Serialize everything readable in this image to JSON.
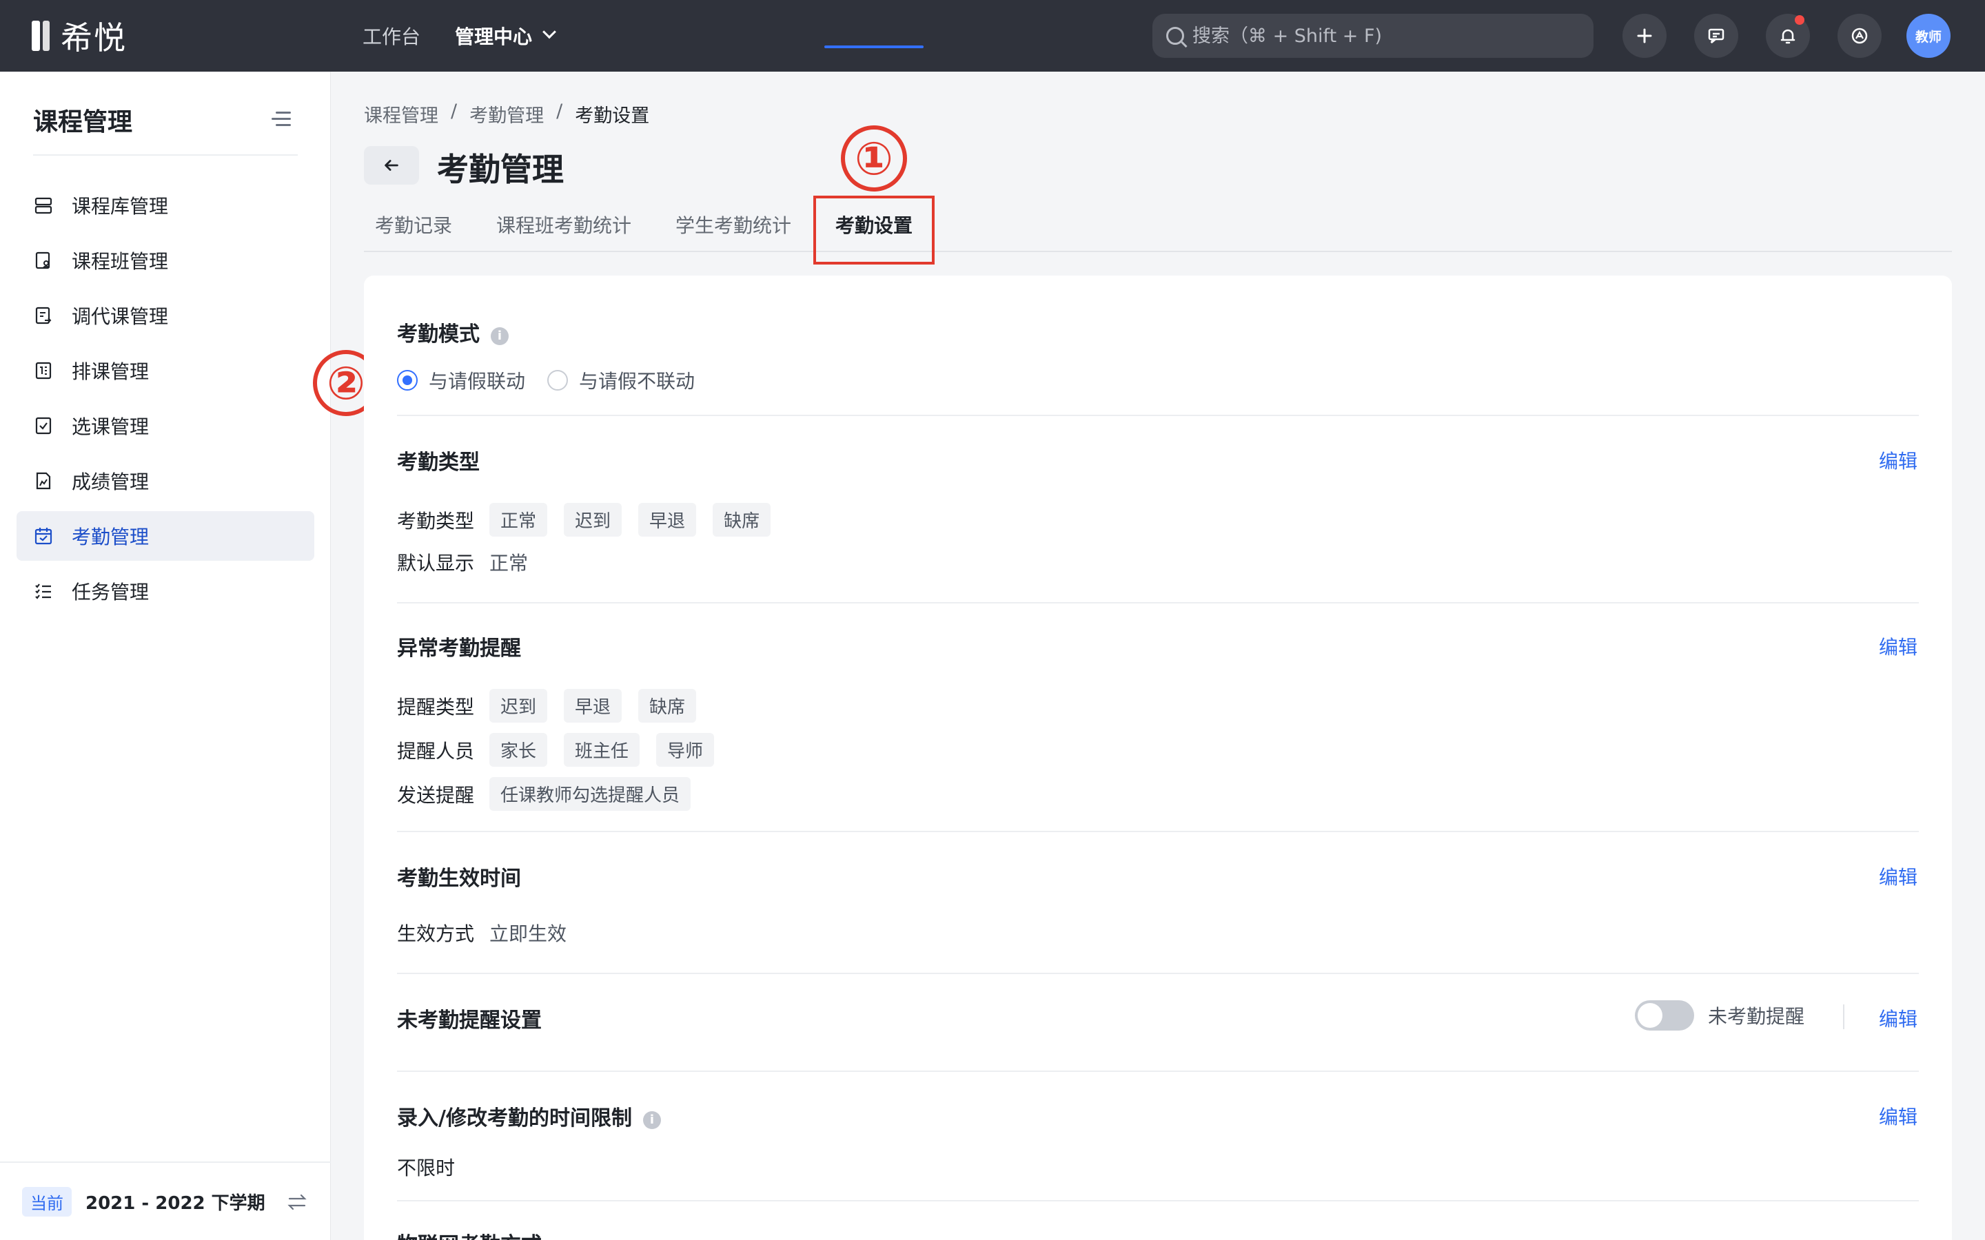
{
  "header": {
    "logo_text": "希悦",
    "nav": [
      {
        "label": "工作台"
      },
      {
        "label": "管理中心"
      }
    ],
    "search_placeholder": "搜索（⌘ + Shift + F)",
    "avatar_text": "教师",
    "accent": "#3370ff"
  },
  "sidebar": {
    "title": "课程管理",
    "items": [
      {
        "label": "课程库管理",
        "icon": "database-icon"
      },
      {
        "label": "课程班管理",
        "icon": "class-icon"
      },
      {
        "label": "调代课管理",
        "icon": "swap-course-icon"
      },
      {
        "label": "排课管理",
        "icon": "schedule-icon"
      },
      {
        "label": "选课管理",
        "icon": "checkbox-icon"
      },
      {
        "label": "成绩管理",
        "icon": "grade-icon"
      },
      {
        "label": "考勤管理",
        "icon": "calendar-check-icon",
        "active": true
      },
      {
        "label": "任务管理",
        "icon": "task-list-icon"
      }
    ],
    "term_badge": "当前",
    "term_text": "2021 - 2022 下学期"
  },
  "breadcrumb": [
    "课程管理",
    "考勤管理",
    "考勤设置"
  ],
  "page_title": "考勤管理",
  "tabs": [
    {
      "label": "考勤记录"
    },
    {
      "label": "课程班考勤统计"
    },
    {
      "label": "学生考勤统计"
    },
    {
      "label": "考勤设置",
      "active": true
    }
  ],
  "annotations": {
    "one": "①",
    "two": "②"
  },
  "settings": {
    "mode": {
      "title": "考勤模式",
      "options": [
        {
          "label": "与请假联动",
          "selected": true
        },
        {
          "label": "与请假不联动",
          "selected": false
        }
      ]
    },
    "type": {
      "title": "考勤类型",
      "edit": "编辑",
      "row1_label": "考勤类型",
      "row1_chips": [
        "正常",
        "迟到",
        "早退",
        "缺席"
      ],
      "row2_label": "默认显示",
      "row2_value": "正常"
    },
    "abnormal": {
      "title": "异常考勤提醒",
      "edit": "编辑",
      "row1_label": "提醒类型",
      "row1_chips": [
        "迟到",
        "早退",
        "缺席"
      ],
      "row2_label": "提醒人员",
      "row2_chips": [
        "家长",
        "班主任",
        "导师"
      ],
      "row3_label": "发送提醒",
      "row3_chips": [
        "任课教师勾选提醒人员"
      ]
    },
    "effective": {
      "title": "考勤生效时间",
      "edit": "编辑",
      "row_label": "生效方式",
      "row_value": "立即生效"
    },
    "unattended": {
      "title": "未考勤提醒设置",
      "toggle_label": "未考勤提醒",
      "toggle_on": false,
      "edit": "编辑"
    },
    "time_limit": {
      "title": "录入/修改考勤的时间限制",
      "edit": "编辑",
      "value": "不限时"
    },
    "next_title": "物联网考勤方式"
  }
}
